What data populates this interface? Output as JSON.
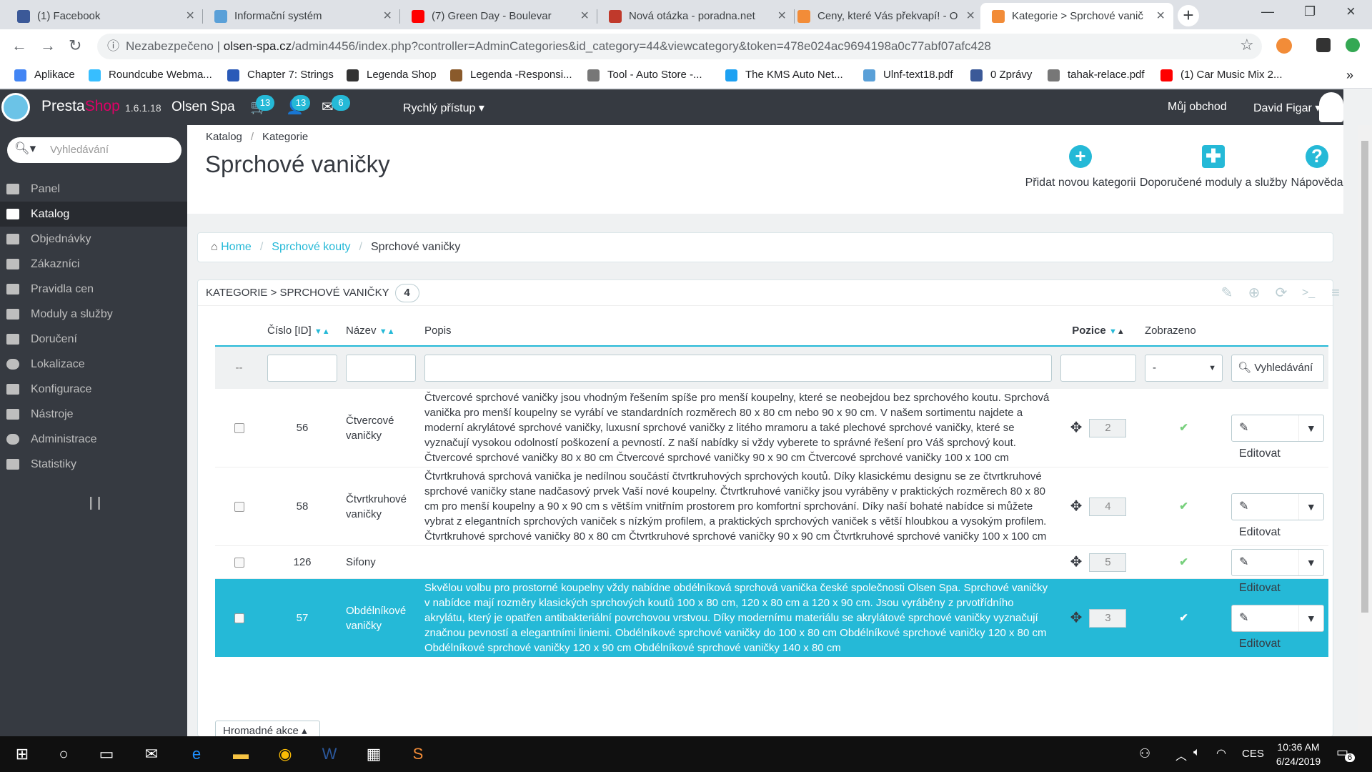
{
  "browser": {
    "tabs": [
      {
        "title": "(1) Facebook",
        "color": "#3b5998"
      },
      {
        "title": "Informační systém",
        "color": "#5aa0d8"
      },
      {
        "title": "(7) Green Day - Boulevar",
        "color": "#ff0000"
      },
      {
        "title": "Nová otázka - poradna.net",
        "color": "#c0392b"
      },
      {
        "title": "Ceny, které Vás překvapí! - O",
        "color": "#f28c38"
      },
      {
        "title": "Kategorie > Sprchové vanič",
        "color": "#f28c38"
      }
    ],
    "address": {
      "security": "Nezabezpečeno",
      "host": "olsen-spa.cz",
      "path": "/admin4456/index.php?controller=AdminCategories&id_category=44&viewcategory&token=478e024ac9694198a0c77abf07afc428"
    },
    "bookmarks": [
      {
        "label": "Aplikace",
        "color": "#4285f4"
      },
      {
        "label": "Roundcube Webma...",
        "color": "#37beff"
      },
      {
        "label": "Chapter 7: Strings",
        "color": "#2a5ab8"
      },
      {
        "label": "Legenda Shop",
        "color": "#333333"
      },
      {
        "label": "Legenda -Responsi...",
        "color": "#8a5a2b"
      },
      {
        "label": "Tool - Auto Store -...",
        "color": "#777777"
      },
      {
        "label": "The KMS Auto Net...",
        "color": "#1da1f2"
      },
      {
        "label": "Ulnf-text18.pdf",
        "color": "#5aa0d8"
      },
      {
        "label": "0 Zprávy",
        "color": "#3b5998"
      },
      {
        "label": "tahak-relace.pdf",
        "color": "#777777"
      },
      {
        "label": "(1) Car Music Mix 2...",
        "color": "#ff0000"
      }
    ]
  },
  "header": {
    "brand_a": "Presta",
    "brand_b": "Shop",
    "version": "1.6.1.18",
    "shop": "Olsen Spa",
    "badges": {
      "orders": "13",
      "customers": "13",
      "messages": "6"
    },
    "quick_access": "Rychlý přístup",
    "my_shop": "Můj obchod",
    "user": "David Figar"
  },
  "sidebar": {
    "search_placeholder": "Vyhledávání",
    "items": [
      {
        "label": "Panel"
      },
      {
        "label": "Katalog",
        "active": true
      },
      {
        "label": "Objednávky"
      },
      {
        "label": "Zákazníci"
      },
      {
        "label": "Pravidla cen"
      },
      {
        "label": "Moduly a služby"
      },
      {
        "label": "Doručení"
      },
      {
        "label": "Lokalizace"
      },
      {
        "label": "Konfigurace"
      },
      {
        "label": "Nástroje"
      },
      {
        "label": "Administrace"
      },
      {
        "label": "Statistiky"
      }
    ]
  },
  "pagehead": {
    "crumb1": "Katalog",
    "crumb2": "Kategorie",
    "title": "Sprchové vaničky",
    "tools": {
      "add": "Přidat novou kategorii",
      "modules": "Doporučené moduly a služby",
      "help": "Nápověda"
    }
  },
  "breadcrumb": {
    "home": "Home",
    "parent": "Sprchové kouty",
    "current": "Sprchové vaničky"
  },
  "panel": {
    "heading": "Kategorie > Sprchové vaničky",
    "count": "4",
    "columns": {
      "id": "Číslo [ID]",
      "name": "Název",
      "desc": "Popis",
      "position": "Pozice",
      "shown": "Zobrazeno"
    },
    "filter": {
      "dash": "--",
      "shown_value": "-",
      "search": "Vyhledávání"
    },
    "edit_label": "Editovat",
    "bulk": "Hromadné akce",
    "rows": [
      {
        "id": "56",
        "name": "Čtvercové vaničky",
        "position": "2",
        "desc": "Čtvercové sprchové vaničky jsou vhodným řešením spíše pro menší koupelny, které se neobejdou bez sprchového koutu. Sprchová vanička pro menší koupelny se vyrábí ve standardních rozměrech 80 x 80 cm nebo 90 x 90 cm. V našem sortimentu najdete a moderní akrylátové sprchové vaničky, luxusní sprchové vaničky z litého mramoru a také plechové sprchové vaničky, které se vyznačují vysokou odolností poškození a pevností. Z naší nabídky si vždy vyberete to správné řešení pro Váš sprchový kout.  Čtvercové sprchové vaničky 80 x 80 cm Čtvercové sprchové vaničky 90 x 90 cm Čtvercové sprchové vaničky 100 x 100 cm"
      },
      {
        "id": "58",
        "name": "Čtvrtkruhové vaničky",
        "position": "4",
        "desc": "Čtvrtkruhová sprchová vanička je nedílnou součástí čtvrtkruhových sprchových koutů. Díky klasickému designu se ze čtvrtkruhové sprchové vaničky stane nadčasový prvek Vaší nové koupelny. Čtvrtkruhové vaničky jsou vyráběny v praktických rozměrech 80 x 80 cm pro menší koupelny a 90 x 90 cm s větším vnitřním prostorem pro komfortní sprchování. Díky naší bohaté nabídce si můžete vybrat z elegantních sprchových vaniček s nízkým profilem, a praktických sprchových vaniček s větší hloubkou a vysokým profilem.  Čtvrtkruhové sprchové vaničky 80 x 80 cm Čtvrtkruhové sprchové vaničky 90 x 90 cm Čtvrtkruhové sprchové vaničky 100 x 100 cm"
      },
      {
        "id": "126",
        "name": "Sifony",
        "position": "5",
        "desc": ""
      },
      {
        "id": "57",
        "name": "Obdélníkové vaničky",
        "position": "3",
        "selected": true,
        "desc": "Skvělou volbu pro prostorné koupelny vždy nabídne obdélníková sprchová vanička české společnosti Olsen Spa. Sprchové vaničky v nabídce mají rozměry klasických sprchových koutů 100 x 80 cm, 120 x 80 cm a 120 x 90 cm. Jsou vyráběny z prvotřídního akrylátu, který je opatřen antibakteriální povrchovou vrstvou. Díky modernímu materiálu se akrylátové sprchové vaničky vyznačují značnou pevností a elegantními liniemi.  Obdélníkové sprchové vaničky do 100 x 80 cm Obdélníkové sprchové vaničky 120 x 80 cm Obdélníkové sprchové vaničky 120 x 90 cm Obdélníkové sprchové vaničky 140 x 80 cm"
      }
    ]
  },
  "taskbar": {
    "lang": "CES",
    "time": "10:36 AM",
    "date": "6/24/2019",
    "notif": "6"
  },
  "colors": {
    "accent": "#25b9d7",
    "dark": "#363a41"
  }
}
